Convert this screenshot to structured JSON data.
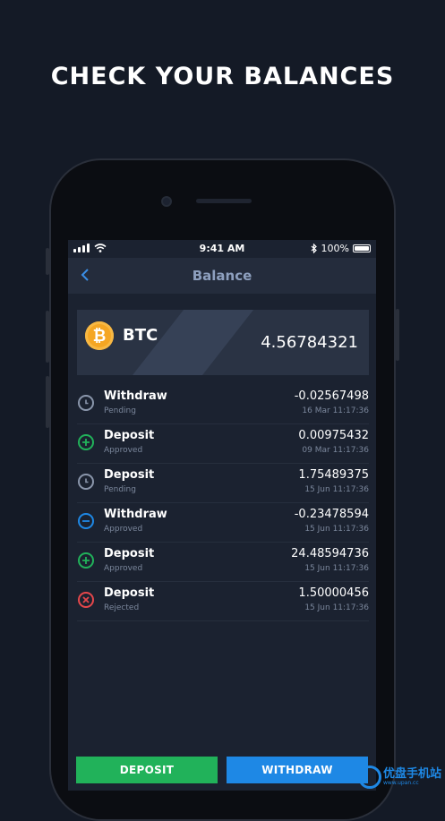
{
  "headline": "CHECK YOUR BALANCES",
  "status_bar": {
    "time": "9:41 AM",
    "battery": "100%"
  },
  "nav": {
    "title": "Balance"
  },
  "balance": {
    "coin_symbol": "₿",
    "coin": "BTC",
    "amount": "4.56784321"
  },
  "transactions": [
    {
      "type": "Withdraw",
      "status": "Pending",
      "amount": "-0.02567498",
      "date": "16 Mar 11:17:36",
      "icon": "clock-icon",
      "color": "#8a96ab"
    },
    {
      "type": "Deposit",
      "status": "Approved",
      "amount": "0.00975432",
      "date": "09 Mar 11:17:36",
      "icon": "plus-circle-icon",
      "color": "#21b25a"
    },
    {
      "type": "Deposit",
      "status": "Pending",
      "amount": "1.75489375",
      "date": "15 Jun 11:17:36",
      "icon": "clock-icon",
      "color": "#8a96ab"
    },
    {
      "type": "Withdraw",
      "status": "Approved",
      "amount": "-0.23478594",
      "date": "15 Jun 11:17:36",
      "icon": "minus-circle-icon",
      "color": "#1e88e5"
    },
    {
      "type": "Deposit",
      "status": "Approved",
      "amount": "24.48594736",
      "date": "15 Jun 11:17:36",
      "icon": "plus-circle-icon",
      "color": "#21b25a"
    },
    {
      "type": "Deposit",
      "status": "Rejected",
      "amount": "1.50000456",
      "date": "15 Jun 11:17:36",
      "icon": "x-circle-icon",
      "color": "#e5474b"
    }
  ],
  "buttons": {
    "deposit": "DEPOSIT",
    "withdraw": "WITHDRAW"
  },
  "watermark": {
    "text": "优盘手机站",
    "sub": "www.upan.cc"
  },
  "colors": {
    "background": "#141a26",
    "deposit": "#21b25a",
    "withdraw": "#1e88e5",
    "rejected": "#e5474b",
    "btc": "#f5a623"
  }
}
